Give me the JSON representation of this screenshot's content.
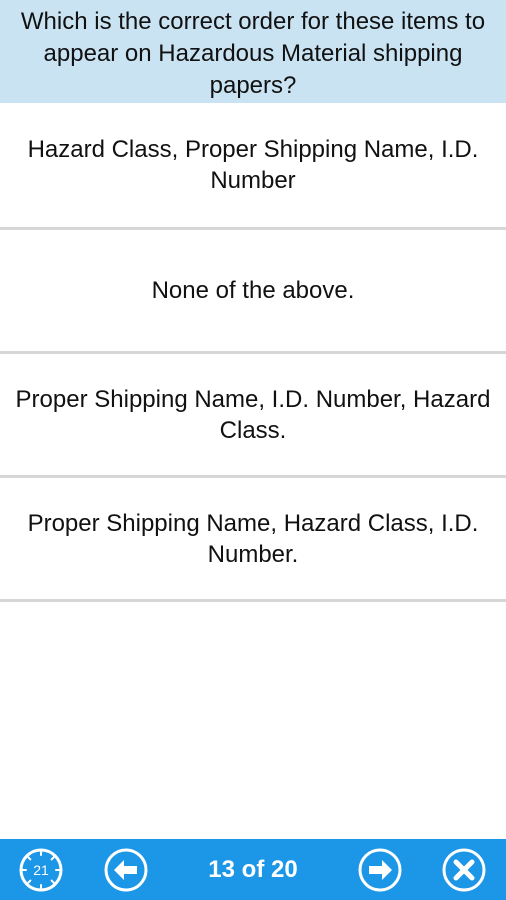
{
  "question": {
    "text": "Which is the correct order for these items to appear on Hazardous Material shipping papers?"
  },
  "answers": [
    "Hazard Class, Proper Shipping Name, I.D. Number",
    "None of the above.",
    "Proper Shipping Name, I.D. Number, Hazard Class.",
    "Proper Shipping Name, Hazard Class, I.D. Number."
  ],
  "toolbar": {
    "timer_value": "21",
    "progress": "13 of 20",
    "icons": [
      "timer-icon",
      "previous-arrow-icon",
      "next-arrow-icon",
      "close-icon"
    ],
    "colors": {
      "bar": "#1c96e6",
      "question_bg": "#c9e3f3"
    }
  }
}
